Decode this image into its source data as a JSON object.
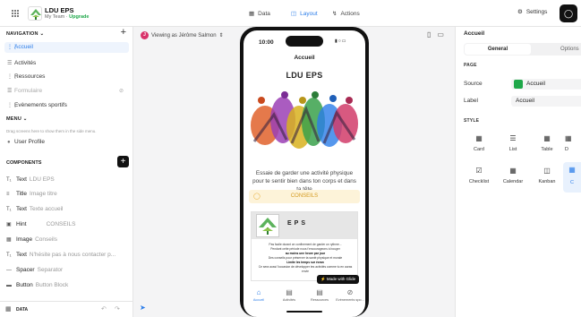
{
  "app": {
    "name": "LDU EPS",
    "team": "My Team · ",
    "upgrade": "Upgrade"
  },
  "top_tabs": {
    "data": "Data",
    "layout": "Layout",
    "actions": "Actions",
    "settings": "Settings"
  },
  "nav": {
    "title": "NAVIGATION",
    "items": [
      {
        "label": "Accueil"
      },
      {
        "label": "Activités"
      },
      {
        "label": "Ressources"
      },
      {
        "label": "Formulaire"
      },
      {
        "label": "Evènements sportifs"
      }
    ]
  },
  "menu": {
    "title": "MENU",
    "hint": "Drag screens here to show them in the side menu.",
    "items": [
      {
        "label": "User Profile"
      }
    ]
  },
  "components": {
    "title": "COMPONENTS",
    "items": [
      {
        "type": "Text",
        "sub": "LDU EPS"
      },
      {
        "type": "Title",
        "sub": "Image titre"
      },
      {
        "type": "Text",
        "sub": "Texte accueil"
      },
      {
        "type": "Hint",
        "sub": "CONSEILS"
      },
      {
        "type": "Image",
        "sub": "Conseils"
      },
      {
        "type": "Text",
        "sub": "N'hésite pas à nous contacter p..."
      },
      {
        "type": "Spacer",
        "sub": "Separator"
      },
      {
        "type": "Button",
        "sub": "Button Block"
      }
    ]
  },
  "data_bar": {
    "label": "DATA"
  },
  "viewing": {
    "label": "Viewing as Jérôme Salmon",
    "initial": "J"
  },
  "phone": {
    "time": "10:00",
    "header": "Accueil",
    "title": "LDU EPS",
    "intro": "Essaie de garder une activité physique pour te sentir bien dans ton corps et dans ta tête",
    "hint": "CONSEILS",
    "card": {
      "eps": "EPS",
      "l1": "Pas facile durant ce confinement de garder un rythme...",
      "l2": "Pendant cette période nous t'encourageons à bouger",
      "l3": "au moins une heure par jour",
      "l4": "Des conseils pour préserver ta santé physique et morale",
      "l5": "Limite les temps sur écran",
      "l6": "Ce sera aussi l'occasion de développer tes activités comme tu en auras envie"
    },
    "badge": "Made with Glide",
    "tabs": [
      {
        "label": "Accueil"
      },
      {
        "label": "Activités"
      },
      {
        "label": "Ressources"
      },
      {
        "label": "Evènements spo..."
      }
    ]
  },
  "right": {
    "title": "Accueil",
    "tab_general": "General",
    "tab_options": "Options",
    "page_section": "PAGE",
    "source_label": "Source",
    "source_value": "Accueil",
    "label_label": "Label",
    "label_value": "Accueil",
    "style_section": "STYLE",
    "styles": [
      {
        "label": "Card"
      },
      {
        "label": "List"
      },
      {
        "label": "Table"
      },
      {
        "label": "D"
      },
      {
        "label": "Checklist"
      },
      {
        "label": "Calendar"
      },
      {
        "label": "Kanban"
      },
      {
        "label": "C"
      }
    ]
  },
  "colors": {
    "accent": "#2b7de9",
    "brand_green": "#1fa84a",
    "avatar": "#d9326a"
  }
}
